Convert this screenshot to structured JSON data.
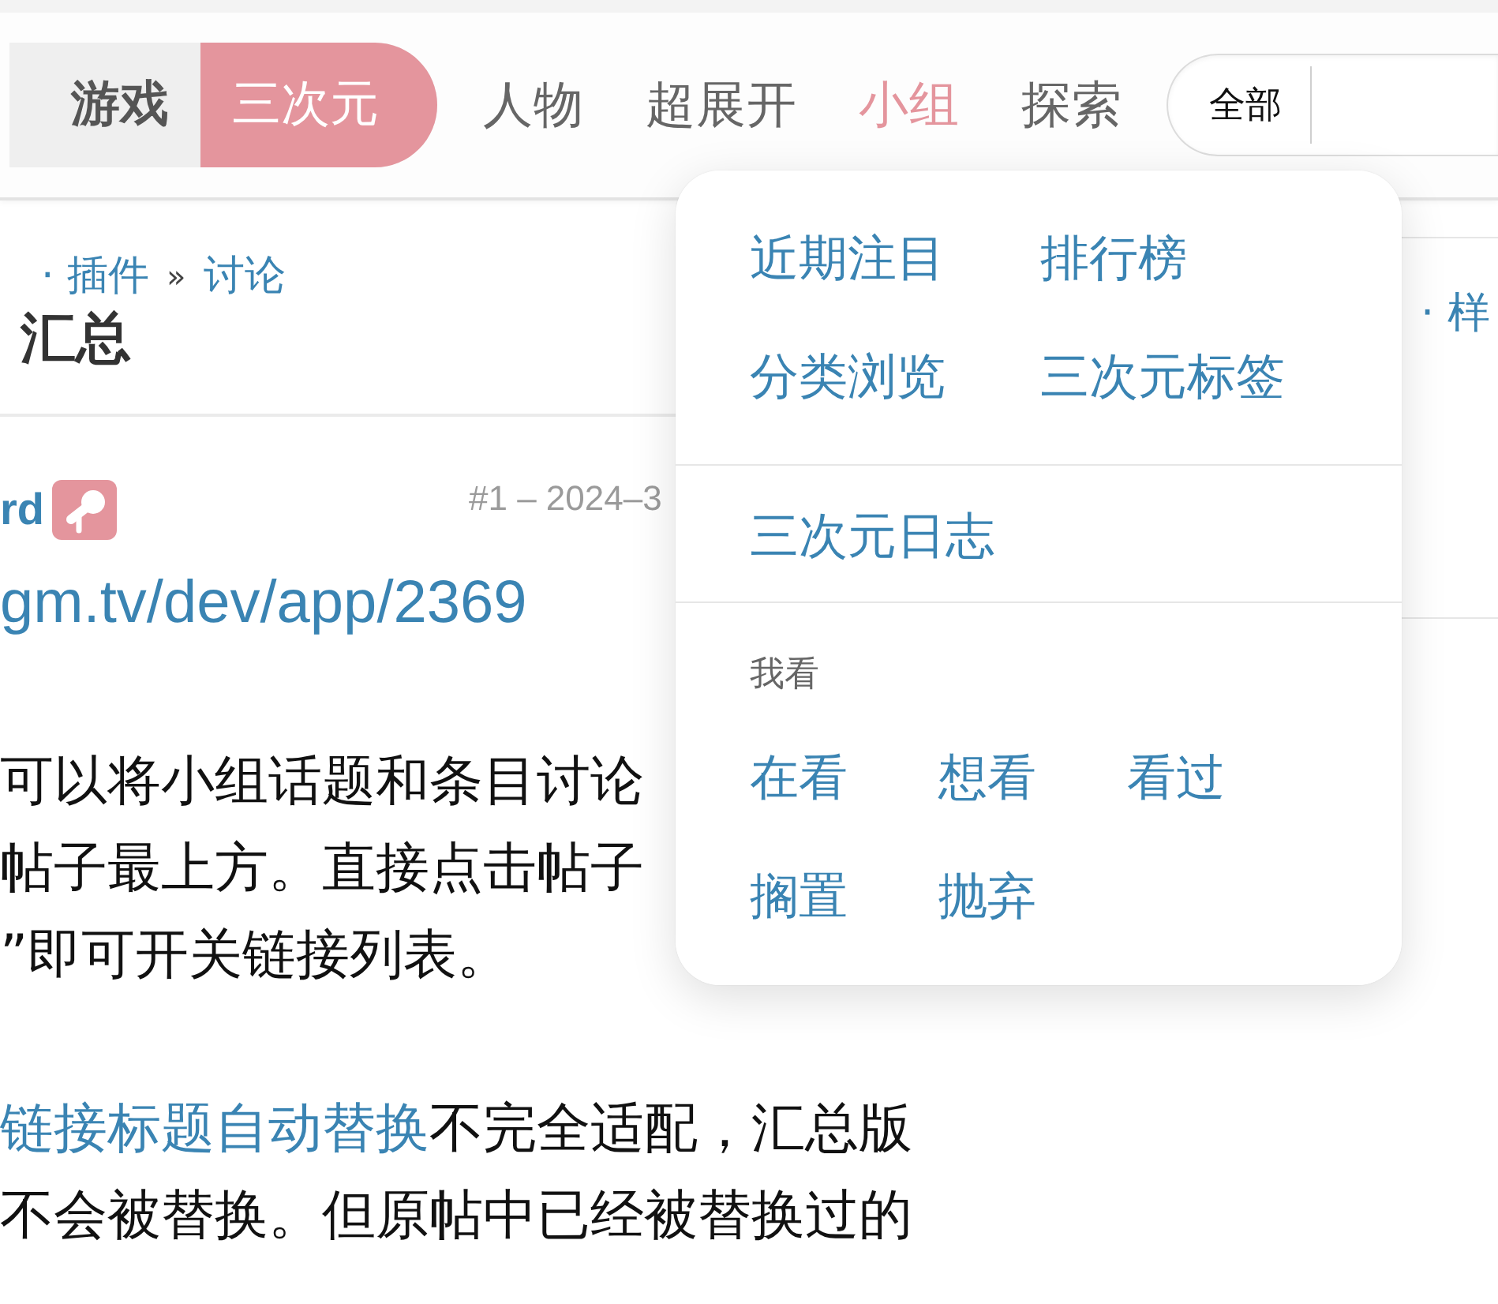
{
  "nav": {
    "category_tabs": [
      {
        "label": "游戏",
        "selected": false
      },
      {
        "label": "三次元",
        "selected": true
      }
    ],
    "links": [
      {
        "label": "人物",
        "selected": false
      },
      {
        "label": "超展开",
        "selected": false
      },
      {
        "label": "小组",
        "selected": true
      },
      {
        "label": "探索",
        "selected": false
      }
    ],
    "search": {
      "scope": "全部"
    }
  },
  "topic": {
    "breadcrumb": {
      "links": [
        "· 插件",
        "讨论"
      ],
      "separator": "»"
    },
    "title": "汇总"
  },
  "post": {
    "author": "rd",
    "meta": "#1 – 2024–3",
    "link": "gm.tv/dev/app/2369",
    "paragraphs": [
      [
        [
          {
            "kind": "text",
            "text": "可以将小组话题和条目讨论"
          }
        ],
        [
          {
            "kind": "text",
            "text": "帖子最上方。直接点击帖子"
          }
        ],
        [
          {
            "kind": "text",
            "text": "”即可开关链接列表。"
          }
        ]
      ],
      [
        [
          {
            "kind": "link",
            "text": "链接标题自动替换"
          },
          {
            "kind": "text",
            "text": "不完全适配，汇总版"
          }
        ],
        [
          {
            "kind": "text",
            "text": "不会被替换。但原帖中已经被替换过的"
          }
        ]
      ]
    ]
  },
  "side_panel": {
    "link": "· 样"
  },
  "dropdown": {
    "sections": [
      {
        "items": [
          "近期注目",
          "排行榜",
          "分类浏览",
          "三次元标签"
        ]
      },
      {
        "items": [
          "三次元日志"
        ]
      },
      {
        "heading": "我看",
        "items": [
          "在看",
          "想看",
          "看过",
          "搁置",
          "抛弃"
        ]
      }
    ]
  }
}
